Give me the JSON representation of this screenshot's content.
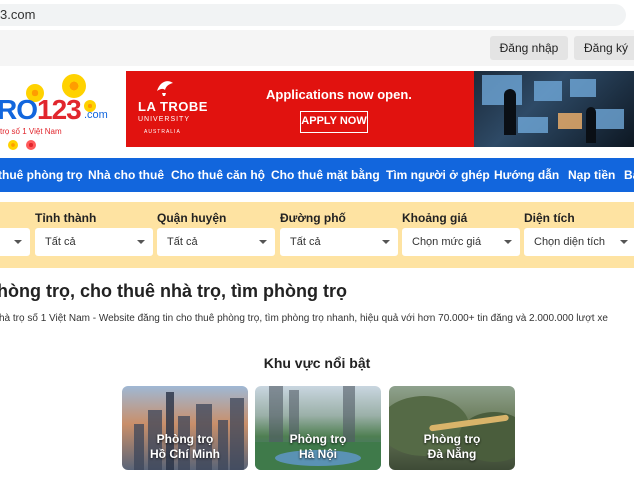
{
  "browser": {
    "url_text": "3.com"
  },
  "auth": {
    "login": "Đăng nhập",
    "register": "Đăng ký"
  },
  "logo": {
    "word_a": "RO",
    "word_b": "123",
    "domain": ".com",
    "tagline": "trọ số 1 Việt Nam"
  },
  "banner": {
    "brand": "LA TROBE",
    "brand_sub": "UNIVERSITY",
    "country": "AUSTRALIA",
    "headline": "Applications now open.",
    "cta": "APPLY NOW"
  },
  "nav": {
    "items": [
      "thuê phòng trọ",
      "Nhà cho thuê",
      "Cho thuê căn hộ",
      "Cho thuê mặt bằng",
      "Tìm người ở ghép",
      "Hướng dẫn",
      "Nạp tiền",
      "Bả"
    ]
  },
  "filters": {
    "fields": [
      {
        "label": "",
        "value": ""
      },
      {
        "label": "Tỉnh thành",
        "value": "Tất cả"
      },
      {
        "label": "Quận huyện",
        "value": "Tất cả"
      },
      {
        "label": "Đường phố",
        "value": "Tất cả"
      },
      {
        "label": "Khoảng giá",
        "value": "Chọn mức giá"
      },
      {
        "label": "Diện tích",
        "value": "Chọn diện tích"
      }
    ]
  },
  "main": {
    "title": "hòng trọ, cho thuê nhà trọ, tìm phòng trọ",
    "description": "hà trọ số 1 Việt Nam - Website đăng tin cho thuê phòng trọ, tìm phòng trọ nhanh, hiệu quả với hơn 70.000+ tin đăng và 2.000.000 lượt xe",
    "section_title": "Khu vực nổi bật",
    "regions": [
      {
        "line1": "Phòng trọ",
        "line2": "Hồ Chí Minh"
      },
      {
        "line1": "Phòng trọ",
        "line2": "Hà Nội"
      },
      {
        "line1": "Phòng trọ",
        "line2": "Đà Nẵng"
      }
    ]
  },
  "colors": {
    "brand_blue": "#1266dd",
    "brand_red": "#e1262d",
    "filter_bg": "#fee3a2",
    "banner_red": "#e1120f"
  }
}
